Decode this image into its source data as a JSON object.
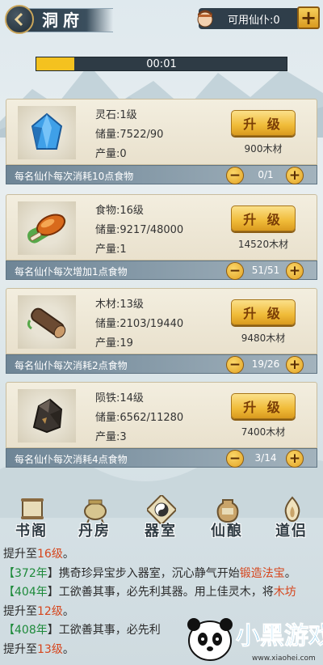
{
  "header": {
    "title": "洞府",
    "servants_label": "可用仙仆:0",
    "plus": "+"
  },
  "progress": {
    "time": "00:01",
    "fill_percent": 15
  },
  "cards": [
    {
      "name": "灵石",
      "level": "灵石:1级",
      "storage": "储量:7522/90",
      "output": "产量:0",
      "upgrade": "升 级",
      "cost": "900木材",
      "consume": "每名仙仆每次消耗10点食物",
      "count": "0/1"
    },
    {
      "name": "食物",
      "level": "食物:16级",
      "storage": "储量:9217/48000",
      "output": "产量:1",
      "upgrade": "升 级",
      "cost": "14520木材",
      "consume": "每名仙仆每次增加1点食物",
      "count": "51/51"
    },
    {
      "name": "木材",
      "level": "木材:13级",
      "storage": "储量:2103/19440",
      "output": "产量:19",
      "upgrade": "升 级",
      "cost": "9480木材",
      "consume": "每名仙仆每次消耗2点食物",
      "count": "19/26"
    },
    {
      "name": "陨铁",
      "level": "陨铁:14级",
      "storage": "储量:6562/11280",
      "output": "产量:3",
      "upgrade": "升 级",
      "cost": "7400木材",
      "consume": "每名仙仆每次消耗4点食物",
      "count": "3/14"
    }
  ],
  "nav": [
    "书阁",
    "丹房",
    "器室",
    "仙酿",
    "道侣"
  ],
  "log": {
    "l1_a": "提升至",
    "l1_b": "16级",
    "l1_c": "。",
    "l2_a": "【",
    "l2_yr": "372年",
    "l2_b": "】携奇珍异宝步入器室，沉心静气开始",
    "l2_hl": "锻造法宝",
    "l2_c": "。",
    "l3_a": "【",
    "l3_yr": "404年",
    "l3_b": "】工欲善其事，必先利其器。用上佳灵木，将",
    "l3_hl": "木坊",
    "l4_a": "提升至",
    "l4_b": "12级",
    "l4_c": "。",
    "l5_a": "【",
    "l5_yr": "408年",
    "l5_b": "】工欲善其事，必先利",
    "l6_a": "提升至",
    "l6_b": "13级",
    "l6_c": "。"
  },
  "watermark": {
    "text": "小黑游戏",
    "url": "www.xiaohei.com"
  }
}
